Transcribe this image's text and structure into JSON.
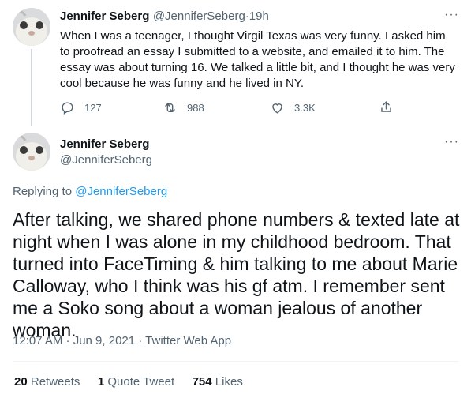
{
  "reply_tweet": {
    "author_name": "Jennifer Seberg",
    "author_handle": "@JenniferSeberg",
    "sep": "·",
    "age": "19h",
    "text": "When I was a teenager, I thought Virgil Texas was very funny. I asked him to proofread an essay I submitted to a website, and emailed it to him. The essay was about turning 16. We talked a little bit, and I thought he was very cool because he was funny and he lived in NY.",
    "more_label": "···",
    "actions": {
      "replies": "127",
      "retweets": "988",
      "likes": "3.3K"
    }
  },
  "main_tweet": {
    "author_name": "Jennifer Seberg",
    "author_handle": "@JenniferSeberg",
    "more_label": "···",
    "replying_prefix": "Replying to ",
    "replying_handle": "@JenniferSeberg",
    "text": "After talking, we shared phone numbers & texted late at night when I was alone in my childhood bedroom. That turned into FaceTiming & him talking to me about Marie Calloway, who I think was his gf atm. I remember sent me a Soko song about a woman jealous of another woman.",
    "meta": "12:07 AM · Jun 9, 2021 · Twitter Web App",
    "stats": {
      "retweets_count": "20",
      "retweets_label": "Retweets",
      "quotes_count": "1",
      "quotes_label": "Quote Tweet",
      "likes_count": "754",
      "likes_label": "Likes"
    }
  },
  "colors": {
    "link": "#1d9bf0",
    "muted": "#536471",
    "text": "#0f1419"
  },
  "icons": [
    "reply-icon",
    "retweet-icon",
    "like-icon",
    "share-icon",
    "more-icon"
  ]
}
